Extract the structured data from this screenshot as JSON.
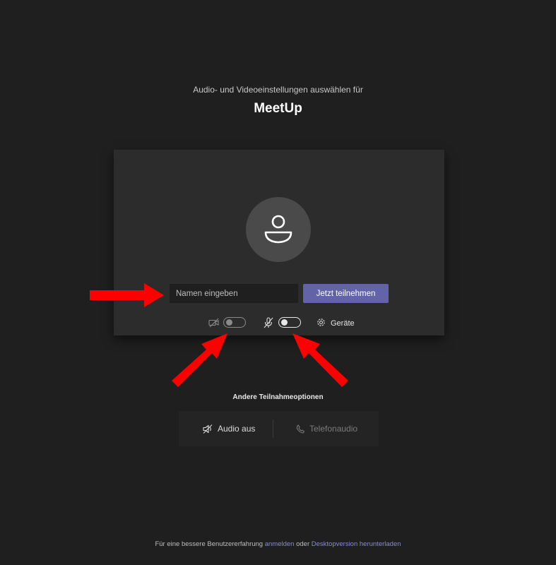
{
  "header": {
    "subtitle": "Audio- und Videoeinstellungen auswählen für",
    "meeting_name": "MeetUp"
  },
  "preview": {
    "name_placeholder": "Namen eingeben",
    "join_label": "Jetzt teilnehmen",
    "camera_toggle": {
      "state": "off",
      "icon": "camera-off-icon"
    },
    "mic_toggle": {
      "state": "off",
      "icon": "mic-off-icon"
    },
    "devices_label": "Geräte",
    "devices_icon": "gear-icon"
  },
  "other_options": {
    "heading": "Andere Teilnahmeoptionen",
    "audio_off_label": "Audio aus",
    "phone_audio_label": "Telefonaudio"
  },
  "footer": {
    "text_before": "Für eine bessere Benutzererfahrung",
    "sign_in_link": "anmelden",
    "text_between": "oder",
    "download_link": "Desktopversion herunterladen"
  },
  "colors": {
    "background": "#1f1f1f",
    "card": "#2d2c2c",
    "accent": "#6264a7",
    "link": "#8b8cc7",
    "annotation_arrow": "#ff0000"
  }
}
